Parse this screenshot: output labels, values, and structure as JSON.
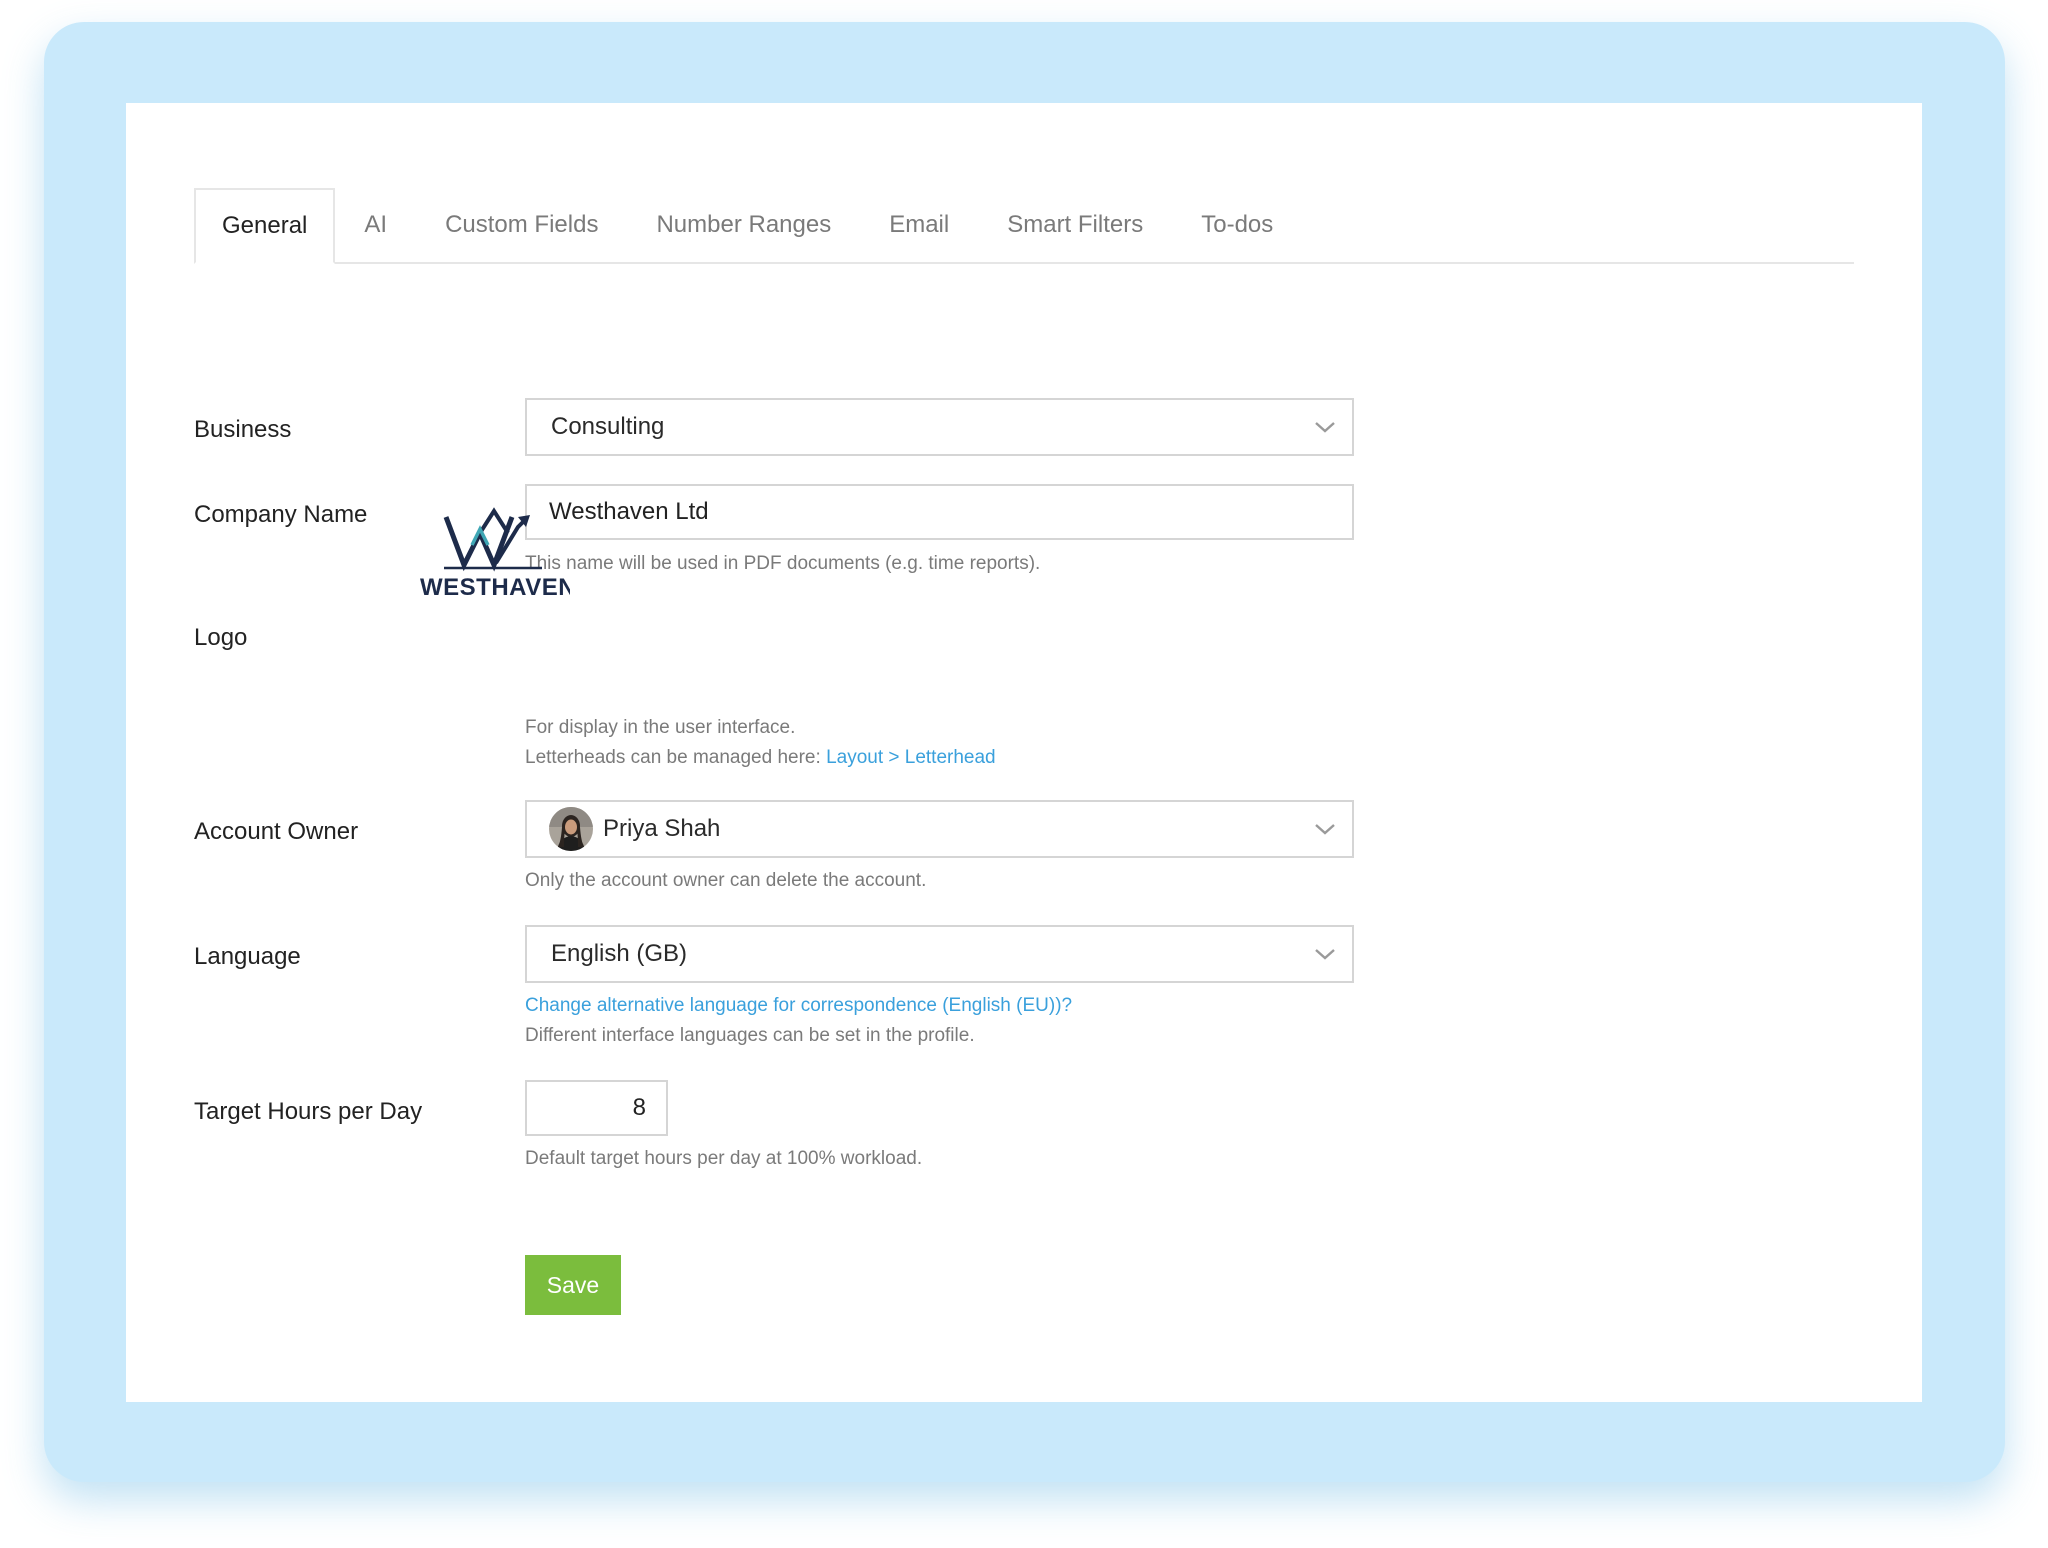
{
  "tabs": [
    {
      "label": "General",
      "active": true
    },
    {
      "label": "AI"
    },
    {
      "label": "Custom Fields"
    },
    {
      "label": "Number Ranges"
    },
    {
      "label": "Email"
    },
    {
      "label": "Smart Filters"
    },
    {
      "label": "To-dos"
    }
  ],
  "business": {
    "label": "Business",
    "value": "Consulting"
  },
  "company_name": {
    "label": "Company Name",
    "value": "Westhaven Ltd",
    "help": "This name will be used in PDF documents (e.g. time reports)."
  },
  "logo": {
    "label": "Logo",
    "logo_text": "WESTHAVEN",
    "help_line1": "For display in the user interface.",
    "help_line2_prefix": "Letterheads can be managed here: ",
    "help_link": "Layout > Letterhead"
  },
  "account_owner": {
    "label": "Account Owner",
    "value": "Priya Shah",
    "help": "Only the account owner can delete the account."
  },
  "language": {
    "label": "Language",
    "value": "English (GB)",
    "link": "Change alternative language for correspondence (English (EU))?",
    "help": "Different interface languages can be set in the profile."
  },
  "target_hours": {
    "label": "Target Hours per Day",
    "value": "8",
    "help": "Default target hours per day at 100% workload."
  },
  "save_label": "Save",
  "colors": {
    "background_frame": "#c9e9fb",
    "link": "#3aa0dc",
    "save_button": "#7bbd3d",
    "logo_navy": "#1d2b4a",
    "logo_teal": "#3fa7b5"
  }
}
